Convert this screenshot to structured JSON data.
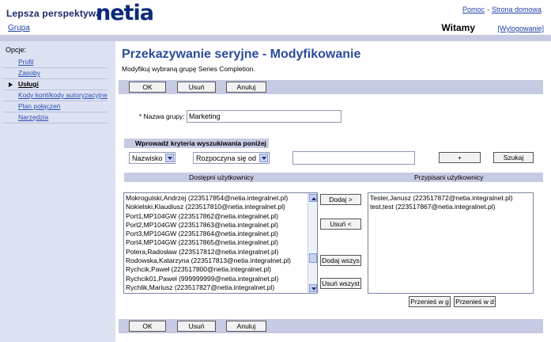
{
  "header": {
    "logo_text": "Lepsza perspektywa",
    "logo_word": "netia",
    "help_link": "Pomoc",
    "separator": "-",
    "home_link": "Strona domowa",
    "group_link": "Grupa",
    "welcome": "Witamy",
    "logout": "[Wylogowanie]"
  },
  "sidebar": {
    "title": "Opcje:",
    "items": [
      {
        "label": "Profil"
      },
      {
        "label": "Zasoby"
      },
      {
        "label": "Usługi"
      },
      {
        "label": "Kody kont/kody autoryzacyjne"
      },
      {
        "label": "Plan połączeń"
      },
      {
        "label": "Narzędzia"
      }
    ]
  },
  "page": {
    "title": "Przekazywanie seryjne - Modyfikowanie",
    "subtitle": "Modyfikuj wybraną grupę Series Completion."
  },
  "buttons": {
    "ok": "OK",
    "delete": "Usuń",
    "cancel": "Anuluj"
  },
  "form": {
    "group_name_label": "* Nazwa grupy:",
    "group_name_value": "Marketing"
  },
  "search": {
    "header": "Wprowadź kryteria wyszukiwania poniżej",
    "field_select": "Nazwisko",
    "mode_select": "Rozpoczyna się od",
    "query_value": "",
    "plus_button": "+",
    "search_button": "Szukaj"
  },
  "available": {
    "header": "Dostępni użytkownicy",
    "users": [
      "Mokrogulski,Andrzej (223517854@netia.integralnet.pl)",
      "Nokielski,Klaudiusz (223517810@netia.integralnet.pl)",
      "Port1,MP104GW (223517862@netia.integralnet.pl)",
      "Port2,MP104GW (223517863@netia.integralnet.pl)",
      "Port3,MP104GW (223517864@netia.integralnet.pl)",
      "Port4,MP104GW (223517865@netia.integralnet.pl)",
      "Potera,Radosław (223517812@netia.integralnet.pl)",
      "Rodowska,Katarzyna (223517813@netia.integralnet.pl)",
      "Rychcik,Paweł (223517800@netia.integralnet.pl)",
      "Rychcik01,Paweł (999999999@netia.integralnet.pl)",
      "Rychlik,Mariusz (223517827@netia.integralnet.pl)"
    ]
  },
  "assigned": {
    "header": "Przypisani użytkownicy",
    "users": [
      "Tester,Janusz (223517872@netia.integralnet.pl)",
      "test,test (223517867@netia.integralnet.pl)"
    ]
  },
  "transfer": {
    "add": "Dodaj >",
    "remove": "Usuń <",
    "add_all": "Dodaj wszys",
    "remove_all": "Usuń wszyst",
    "move_up": "Przenieś w g",
    "move_down": "Przenieś w d"
  },
  "colors": {
    "brand": "#0d2a7a",
    "title": "#2b4c9a",
    "bar": "#c6cbe3",
    "sidebar": "#dde2f2",
    "link": "#1d3fa6"
  }
}
